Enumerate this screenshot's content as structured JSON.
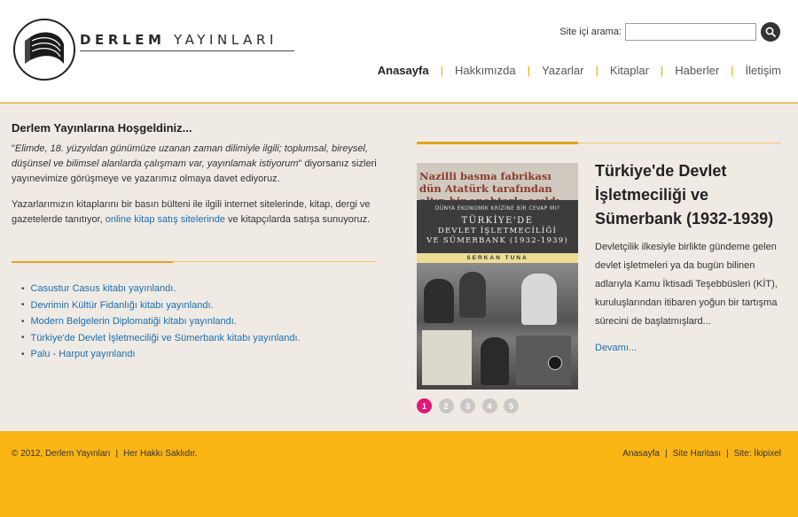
{
  "header": {
    "logo_name": "DERLEM",
    "logo_sub": "YAYINLARI",
    "search_label": "Site içi arama:",
    "search_value": "",
    "nav": [
      "Anasayfa",
      "Hakkımızda",
      "Yazarlar",
      "Kitaplar",
      "Haberler",
      "İletişim"
    ]
  },
  "welcome": {
    "title": "Derlem Yayınlarına Hoşgeldiniz...",
    "quote_open": "\"",
    "quote": "Elimde, 18. yüzyıldan günümüze uzanan zaman dilimiyle ilgili; toplumsal, bireysel, düşünsel ve bilimsel alanlarda çalışmam var, yayınlamak istiyorum",
    "quote_close": "\" diyorsanız sizleri yayınevimize görüşmeye ve yazarımız olmaya davet ediyoruz.",
    "p2_before": "Yazarlarımızın kitaplarını bir basın bülteni ile ilgili internet sitelerinde, kitap, dergi ve gazetelerde tanıtıyor, ",
    "p2_link": "online kitap satış sitelerinde",
    "p2_after": " ve kitapçılarda satışa sunuyoruz."
  },
  "news": [
    "Casustur Casus kitabı yayınlandı.",
    "Devrimin Kültür Fidanlığı kitabı yayınlandı.",
    "Modern Belgelerin Diplomatiği kitabı yayınlandı.",
    "Türkiye'de Devlet İşletmeciliği ve Sümerbank kitabı yayınlandı.",
    "Palu - Harput yayınlandı"
  ],
  "book_cover": {
    "headline": "Nazilli basma fabrikası dün Atatürk tarafından altın bir anahtarla açıldı",
    "subtitle": "DÜNYA EKONOMİK KRİZİNE BİR CEVAP MI?",
    "title_line1": "TÜRKİYE'DE",
    "title_line2": "DEVLET İŞLETMECİLİĞİ",
    "title_line3": "VE SÜMERBANK (1932-1939)",
    "author": "SERKAN TUNA"
  },
  "feature": {
    "title": "Türkiye'de Devlet İşletmeciliği ve Sümerbank (1932-1939)",
    "text": "Devletçilik ilkesiyle birlikte gündeme gelen devlet işletmeleri ya da bugün bilinen adlarıyla Kamu İktisadi Teşebbüsleri (KİT), kuruluşlarından itibaren yoğun bir tartışma sürecini de başlatmışlard...",
    "more": "Devamı..."
  },
  "slider": {
    "pages": [
      "1",
      "2",
      "3",
      "4",
      "5"
    ],
    "active": "1"
  },
  "footer": {
    "copyright": "© 2012, Derlem Yayınları",
    "rights": "Her Hakkı Saklıdır.",
    "links": [
      "Anasayfa",
      "Site Haritası",
      "Site: İkipixel"
    ]
  },
  "colors": {
    "accent": "#fbb515",
    "link": "#1a6db3",
    "active_dot": "#e2177a",
    "divider": "#e2a41c"
  }
}
